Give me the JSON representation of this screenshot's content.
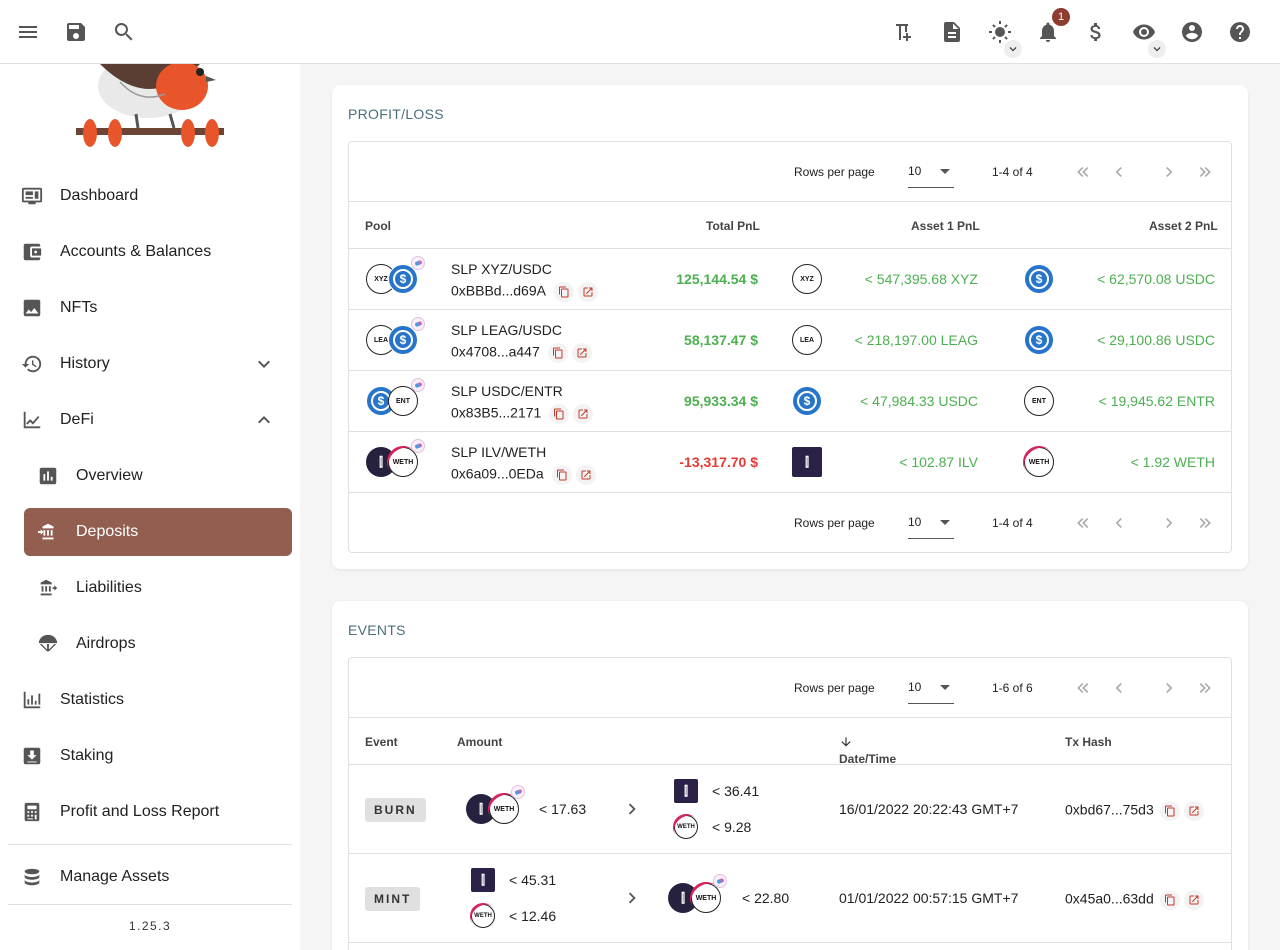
{
  "topbar": {
    "icons": [
      "menu-icon",
      "save-icon",
      "search-icon",
      "pinned-icon",
      "notes-icon",
      "theme-icon",
      "notifications-icon",
      "currency-icon",
      "privacy-icon",
      "account-icon",
      "help-icon"
    ],
    "notification_count": "1"
  },
  "sidebar": {
    "items": [
      {
        "label": "Dashboard",
        "icon": "dashboard-icon"
      },
      {
        "label": "Accounts & Balances",
        "icon": "wallet-icon"
      },
      {
        "label": "NFTs",
        "icon": "image-icon"
      },
      {
        "label": "History",
        "icon": "history-icon"
      },
      {
        "label": "DeFi",
        "icon": "chart-icon"
      },
      {
        "label": "Overview",
        "icon": "bar-chart-icon"
      },
      {
        "label": "Deposits",
        "icon": "deposit-icon"
      },
      {
        "label": "Liabilities",
        "icon": "bank-icon"
      },
      {
        "label": "Airdrops",
        "icon": "parachute-icon"
      },
      {
        "label": "Statistics",
        "icon": "stats-icon"
      },
      {
        "label": "Staking",
        "icon": "staking-icon"
      },
      {
        "label": "Profit and Loss Report",
        "icon": "calculator-icon"
      },
      {
        "label": "Manage Assets",
        "icon": "coins-icon"
      }
    ],
    "version": "1.25.3",
    "accent_color": "#925e50"
  },
  "pnl": {
    "title": "PROFIT/LOSS",
    "rows_per_page_label": "Rows per page",
    "rows_per_page": "10",
    "range": "1-4 of 4",
    "headers": {
      "pool": "Pool",
      "total": "Total PnL",
      "asset1": "Asset 1 PnL",
      "asset2": "Asset 2 PnL"
    },
    "rows": [
      {
        "name": "SLP XYZ/USDC",
        "addr": "0xBBBd...d69A",
        "total": "125,144.54 $",
        "a1": "< 547,395.68 XYZ",
        "a2": "< 62,570.08 USDC",
        "t1": "XYZ",
        "t2": "USDC",
        "neg": false
      },
      {
        "name": "SLP LEAG/USDC",
        "addr": "0x4708...a447",
        "total": "58,137.47 $",
        "a1": "< 218,197.00 LEAG",
        "a2": "< 29,100.86 USDC",
        "t1": "LEA",
        "t2": "USDC",
        "neg": false
      },
      {
        "name": "SLP USDC/ENTR",
        "addr": "0x83B5...2171",
        "total": "95,933.34 $",
        "a1": "< 47,984.33 USDC",
        "a2": "< 19,945.62 ENTR",
        "t1": "USDC",
        "t2": "ENT",
        "neg": false
      },
      {
        "name": "SLP ILV/WETH",
        "addr": "0x6a09...0EDa",
        "total": "-13,317.70 $",
        "a1": "< 102.87 ILV",
        "a2": "< 1.92 WETH",
        "t1": "ILV",
        "t2": "WETH",
        "neg": true
      }
    ]
  },
  "events": {
    "title": "EVENTS",
    "rows_per_page_label": "Rows per page",
    "rows_per_page": "10",
    "range": "1-6 of 6",
    "headers": {
      "event": "Event",
      "amount": "Amount",
      "datetime": "Date/Time",
      "txhash": "Tx Hash"
    },
    "rows": [
      {
        "type": "BURN",
        "in_amount": "< 17.63",
        "out1": "< 36.41",
        "out2": "< 9.28",
        "datetime": "16/01/2022 20:22:43 GMT+7",
        "hash": "0xbd67...75d3"
      },
      {
        "type": "MINT",
        "in1": "< 45.31",
        "in2": "< 12.46",
        "out_amount": "< 22.80",
        "datetime": "01/01/2022 00:57:15 GMT+7",
        "hash": "0x45a0...63dd"
      }
    ]
  }
}
